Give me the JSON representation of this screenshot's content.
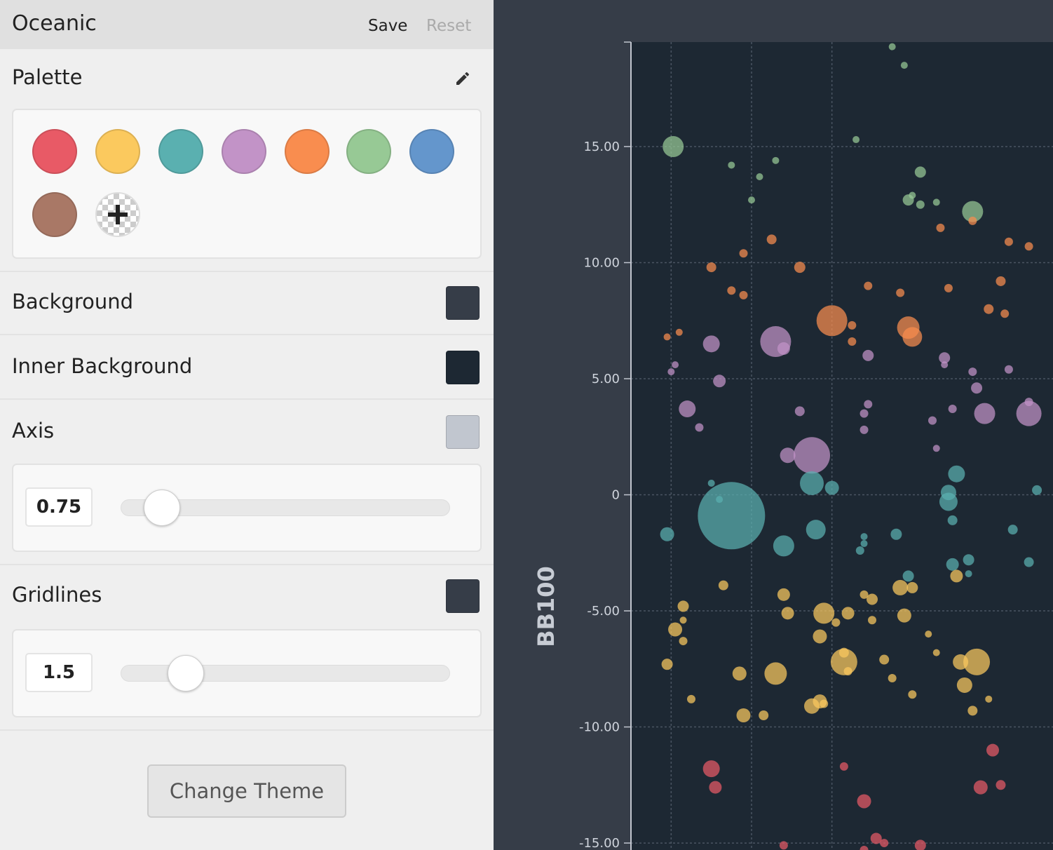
{
  "header": {
    "theme_name": "Oceanic",
    "save_label": "Save",
    "reset_label": "Reset"
  },
  "palette": {
    "label": "Palette",
    "edit_icon": "pencil-icon",
    "add_icon": "plus-icon",
    "colors": [
      "#e85a66",
      "#fbc95e",
      "#5ab0b0",
      "#c293c7",
      "#f98d4f",
      "#97c995",
      "#6496cc",
      "#a97866"
    ]
  },
  "background": {
    "label": "Background",
    "color": "#363d48"
  },
  "inner_background": {
    "label": "Inner Background",
    "color": "#1d2833"
  },
  "axis": {
    "label": "Axis",
    "color": "#c1c6cf",
    "value": "0.75",
    "fraction": 0.08
  },
  "gridlines": {
    "label": "Gridlines",
    "color": "#363d48",
    "value": "1.5",
    "fraction": 0.16
  },
  "change_theme_label": "Change Theme",
  "chart_data": {
    "type": "scatter",
    "ylabel": "BB100",
    "ylim": [
      -15.3,
      19.5
    ],
    "yticks": [
      "15.00",
      "10.00",
      "5.00",
      "0",
      "-5.00",
      "-10.00",
      "-15.00"
    ],
    "grid": true,
    "series": [
      {
        "color": "#97c995",
        "points": [
          [
            1.05,
            15.0,
            15
          ],
          [
            2.5,
            14.2,
            5
          ],
          [
            3.2,
            13.7,
            5
          ],
          [
            3.0,
            12.7,
            5
          ],
          [
            3.6,
            14.4,
            5
          ],
          [
            5.6,
            15.3,
            5
          ],
          [
            6.5,
            19.3,
            5
          ],
          [
            6.8,
            18.5,
            5
          ],
          [
            7.0,
            12.9,
            5
          ],
          [
            7.2,
            13.9,
            8
          ],
          [
            6.9,
            12.7,
            8
          ],
          [
            7.2,
            12.5,
            6
          ],
          [
            7.6,
            12.6,
            5
          ],
          [
            8.5,
            12.2,
            15
          ]
        ]
      },
      {
        "color": "#f98d4f",
        "points": [
          [
            0.9,
            6.8,
            5
          ],
          [
            1.2,
            7.0,
            5
          ],
          [
            2.0,
            9.8,
            7
          ],
          [
            2.5,
            8.8,
            6
          ],
          [
            2.8,
            8.6,
            6
          ],
          [
            2.8,
            10.4,
            6
          ],
          [
            3.5,
            11.0,
            7
          ],
          [
            4.2,
            9.8,
            8
          ],
          [
            5.0,
            7.5,
            22
          ],
          [
            5.5,
            7.3,
            6
          ],
          [
            5.5,
            6.6,
            6
          ],
          [
            5.9,
            9.0,
            6
          ],
          [
            6.7,
            8.7,
            6
          ],
          [
            6.9,
            7.2,
            16
          ],
          [
            7.0,
            6.8,
            14
          ],
          [
            7.7,
            11.5,
            6
          ],
          [
            7.9,
            8.9,
            6
          ],
          [
            8.5,
            11.8,
            6
          ],
          [
            8.9,
            8.0,
            7
          ],
          [
            9.2,
            9.2,
            7
          ],
          [
            9.3,
            7.8,
            6
          ],
          [
            9.4,
            10.9,
            6
          ],
          [
            9.9,
            10.7,
            6
          ]
        ]
      },
      {
        "color": "#c293c7",
        "points": [
          [
            1.0,
            5.3,
            5
          ],
          [
            1.1,
            5.6,
            5
          ],
          [
            1.4,
            3.7,
            12
          ],
          [
            1.7,
            2.9,
            6
          ],
          [
            2.0,
            6.5,
            12
          ],
          [
            2.2,
            4.9,
            9
          ],
          [
            3.6,
            6.6,
            22
          ],
          [
            3.8,
            6.3,
            9
          ],
          [
            4.2,
            3.6,
            7
          ],
          [
            4.5,
            1.7,
            26
          ],
          [
            3.9,
            1.7,
            11
          ],
          [
            5.9,
            6.0,
            8
          ],
          [
            5.8,
            3.5,
            6
          ],
          [
            5.9,
            3.9,
            6
          ],
          [
            5.8,
            2.8,
            6
          ],
          [
            7.5,
            3.2,
            6
          ],
          [
            7.6,
            2.0,
            5
          ],
          [
            7.8,
            5.9,
            8
          ],
          [
            7.8,
            5.6,
            5
          ],
          [
            8.0,
            3.7,
            6
          ],
          [
            8.5,
            5.3,
            6
          ],
          [
            8.6,
            4.6,
            8
          ],
          [
            8.8,
            3.5,
            15
          ],
          [
            9.4,
            5.4,
            6
          ],
          [
            9.9,
            3.5,
            18
          ],
          [
            9.9,
            4.0,
            6
          ]
        ]
      },
      {
        "color": "#5ab0b0",
        "points": [
          [
            0.9,
            -1.7,
            10
          ],
          [
            2.0,
            0.5,
            5
          ],
          [
            2.2,
            -0.2,
            5
          ],
          [
            2.5,
            -0.9,
            48
          ],
          [
            4.5,
            0.5,
            17
          ],
          [
            5.0,
            0.3,
            10
          ],
          [
            3.8,
            -2.2,
            15
          ],
          [
            4.6,
            -1.5,
            14
          ],
          [
            5.8,
            -1.8,
            5
          ],
          [
            5.8,
            -2.1,
            5
          ],
          [
            5.7,
            -2.4,
            6
          ],
          [
            6.6,
            -1.7,
            8
          ],
          [
            6.9,
            -3.5,
            8
          ],
          [
            7.9,
            -0.3,
            13
          ],
          [
            7.9,
            0.1,
            11
          ],
          [
            8.1,
            0.9,
            12
          ],
          [
            8.0,
            -1.1,
            7
          ],
          [
            8.0,
            -3.0,
            9
          ],
          [
            8.4,
            -2.8,
            8
          ],
          [
            8.4,
            -3.4,
            5
          ],
          [
            9.5,
            -1.5,
            7
          ],
          [
            9.9,
            -2.9,
            7
          ],
          [
            10.1,
            0.2,
            7
          ]
        ]
      },
      {
        "color": "#fbc95e",
        "points": [
          [
            0.9,
            -7.3,
            8
          ],
          [
            1.1,
            -5.8,
            10
          ],
          [
            1.3,
            -4.8,
            8
          ],
          [
            1.3,
            -6.3,
            6
          ],
          [
            1.3,
            -5.4,
            5
          ],
          [
            1.5,
            -8.8,
            6
          ],
          [
            2.3,
            -3.9,
            7
          ],
          [
            2.7,
            -7.7,
            10
          ],
          [
            2.8,
            -9.5,
            10
          ],
          [
            3.3,
            -9.5,
            7
          ],
          [
            3.6,
            -7.7,
            16
          ],
          [
            3.8,
            -4.3,
            9
          ],
          [
            3.9,
            -5.1,
            9
          ],
          [
            4.5,
            -9.1,
            11
          ],
          [
            4.7,
            -8.9,
            10
          ],
          [
            4.8,
            -9.0,
            6
          ],
          [
            4.8,
            -5.1,
            15
          ],
          [
            4.7,
            -6.1,
            10
          ],
          [
            5.1,
            -5.5,
            6
          ],
          [
            5.3,
            -7.2,
            19
          ],
          [
            5.3,
            -6.8,
            7
          ],
          [
            5.4,
            -7.6,
            6
          ],
          [
            5.4,
            -5.1,
            9
          ],
          [
            5.8,
            -4.3,
            6
          ],
          [
            6.0,
            -4.5,
            8
          ],
          [
            6.0,
            -5.4,
            6
          ],
          [
            6.3,
            -7.1,
            7
          ],
          [
            6.5,
            -7.9,
            6
          ],
          [
            6.7,
            -4.0,
            11
          ],
          [
            6.8,
            -5.2,
            10
          ],
          [
            7.0,
            -8.6,
            6
          ],
          [
            7.0,
            -4.0,
            8
          ],
          [
            7.4,
            -6.0,
            5
          ],
          [
            7.6,
            -6.8,
            5
          ],
          [
            8.1,
            -3.5,
            9
          ],
          [
            8.2,
            -7.2,
            11
          ],
          [
            8.3,
            -8.2,
            11
          ],
          [
            8.5,
            -9.3,
            7
          ],
          [
            8.6,
            -7.2,
            19
          ],
          [
            8.9,
            -8.8,
            5
          ]
        ]
      },
      {
        "color": "#e85a66",
        "points": [
          [
            2.0,
            -11.8,
            12
          ],
          [
            2.1,
            -12.6,
            9
          ],
          [
            3.8,
            -15.1,
            6
          ],
          [
            5.3,
            -11.7,
            6
          ],
          [
            5.8,
            -15.3,
            6
          ],
          [
            5.8,
            -13.2,
            10
          ],
          [
            6.1,
            -14.8,
            8
          ],
          [
            6.3,
            -15.0,
            6
          ],
          [
            7.2,
            -15.1,
            8
          ],
          [
            8.7,
            -12.6,
            10
          ],
          [
            9.0,
            -11.0,
            9
          ],
          [
            9.2,
            -12.5,
            7
          ]
        ]
      }
    ]
  }
}
